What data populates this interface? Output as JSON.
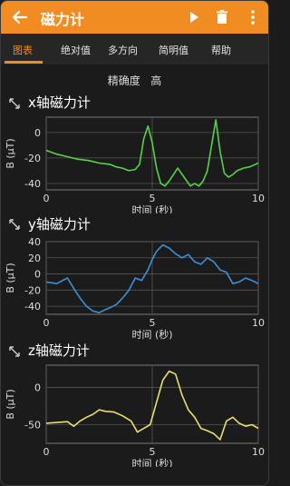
{
  "app": {
    "title": "磁力计"
  },
  "tabs": [
    {
      "label": "图表",
      "active": true
    },
    {
      "label": "绝对值"
    },
    {
      "label": "多方向"
    },
    {
      "label": "简明值"
    },
    {
      "label": "帮助"
    }
  ],
  "precision": {
    "label": "精确度",
    "value": "高"
  },
  "colors": {
    "accent": "#f18c22",
    "x": "#55d24a",
    "y": "#3f8fd6",
    "z": "#e8e06a"
  },
  "icons": [
    "back-arrow-icon",
    "play-icon",
    "trash-icon",
    "more-vert-icon",
    "expand-icon"
  ],
  "charts": [
    {
      "title": "x轴磁力计",
      "xlabel": "时间 (秒)",
      "ylabel": "B (μT)"
    },
    {
      "title": "y轴磁力计",
      "xlabel": "时间 (秒)",
      "ylabel": "B (μT)"
    },
    {
      "title": "z轴磁力计",
      "xlabel": "时间 (秒)",
      "ylabel": "B (μT)"
    }
  ],
  "chart_data": [
    {
      "type": "line",
      "title": "x轴磁力计",
      "xlabel": "时间 (秒)",
      "ylabel": "B (μT)",
      "xlim": [
        0,
        10
      ],
      "ylim": [
        -45,
        12
      ],
      "xticks": [
        "0",
        "5",
        "10"
      ],
      "yticks": [
        "0",
        "-20",
        "-40"
      ],
      "ytick_values": [
        0,
        -20,
        -40
      ],
      "series": [
        {
          "color": "#55d24a",
          "x": [
            0,
            0.5,
            1,
            1.5,
            2,
            2.5,
            3,
            3.3,
            3.6,
            3.9,
            4.2,
            4.4,
            4.6,
            4.8,
            5.0,
            5.2,
            5.4,
            5.6,
            5.8,
            6.0,
            6.2,
            6.5,
            6.8,
            7.0,
            7.2,
            7.4,
            7.6,
            7.8,
            8.0,
            8.2,
            8.4,
            8.6,
            8.8,
            9.0,
            9.3,
            9.6,
            10
          ],
          "y": [
            -14,
            -17,
            -19,
            -21,
            -22,
            -24,
            -25,
            -27,
            -28,
            -30,
            -29,
            -25,
            -5,
            5,
            -8,
            -28,
            -40,
            -42,
            -38,
            -33,
            -28,
            -35,
            -42,
            -40,
            -42,
            -38,
            -30,
            -10,
            10,
            -15,
            -32,
            -35,
            -33,
            -30,
            -28,
            -27,
            -24
          ]
        }
      ]
    },
    {
      "type": "line",
      "title": "y轴磁力计",
      "xlabel": "时间 (秒)",
      "ylabel": "B (μT)",
      "xlim": [
        0,
        10
      ],
      "ylim": [
        -50,
        40
      ],
      "xticks": [
        "0",
        "5",
        "10"
      ],
      "yticks": [
        "40",
        "20",
        "0",
        "-20",
        "-40"
      ],
      "ytick_values": [
        40,
        20,
        0,
        -20,
        -40
      ],
      "series": [
        {
          "color": "#3f8fd6",
          "x": [
            0,
            0.5,
            1.0,
            1.3,
            1.6,
            1.9,
            2.2,
            2.5,
            2.8,
            3.0,
            3.3,
            3.6,
            3.9,
            4.2,
            4.5,
            4.8,
            5.0,
            5.2,
            5.5,
            5.8,
            6.1,
            6.4,
            6.7,
            7.0,
            7.3,
            7.6,
            7.9,
            8.2,
            8.5,
            8.8,
            9.1,
            9.4,
            9.7,
            10
          ],
          "y": [
            -10,
            -12,
            -5,
            -18,
            -30,
            -40,
            -46,
            -48,
            -44,
            -42,
            -38,
            -30,
            -20,
            -5,
            -8,
            5,
            18,
            28,
            36,
            32,
            25,
            20,
            24,
            15,
            12,
            20,
            15,
            5,
            2,
            -12,
            -10,
            -5,
            -8,
            -12
          ]
        }
      ]
    },
    {
      "type": "line",
      "title": "z轴磁力计",
      "xlabel": "时间 (秒)",
      "ylabel": "B (μT)",
      "xlim": [
        0,
        10
      ],
      "ylim": [
        -75,
        30
      ],
      "xticks": [
        "0",
        "5",
        "10"
      ],
      "yticks": [
        "0",
        "-50"
      ],
      "ytick_values": [
        0,
        -50
      ],
      "series": [
        {
          "color": "#e8e06a",
          "x": [
            0,
            0.5,
            1.0,
            1.3,
            1.6,
            1.9,
            2.2,
            2.5,
            2.8,
            3.2,
            3.6,
            4.0,
            4.3,
            4.6,
            4.9,
            5.2,
            5.5,
            5.8,
            6.1,
            6.4,
            6.7,
            7.0,
            7.3,
            7.6,
            7.9,
            8.2,
            8.5,
            8.8,
            9.1,
            9.4,
            9.7,
            10
          ],
          "y": [
            -48,
            -47,
            -46,
            -52,
            -45,
            -40,
            -36,
            -30,
            -32,
            -33,
            -38,
            -45,
            -60,
            -55,
            -50,
            -20,
            10,
            22,
            18,
            -10,
            -30,
            -40,
            -55,
            -58,
            -62,
            -70,
            -45,
            -40,
            -48,
            -52,
            -50,
            -55
          ]
        }
      ]
    }
  ]
}
